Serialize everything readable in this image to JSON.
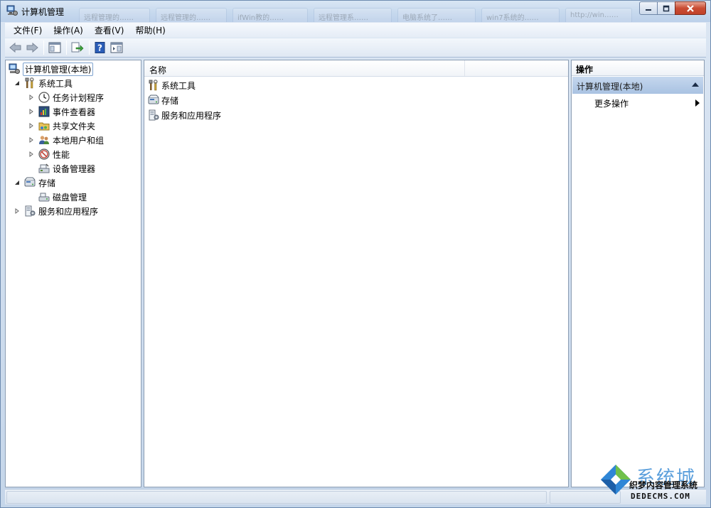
{
  "window": {
    "title": "计算机管理",
    "ghost_tabs": [
      "远程管理的……",
      "远程管理的……",
      "ifWin教的……",
      "远程管理系……",
      "电脑系统了……",
      "win7系统的……",
      "http://win……"
    ]
  },
  "menu": {
    "items": [
      {
        "label": "文件(F)"
      },
      {
        "label": "操作(A)"
      },
      {
        "label": "查看(V)"
      },
      {
        "label": "帮助(H)"
      }
    ]
  },
  "toolbar": {
    "buttons": [
      "back-icon",
      "forward-icon",
      "show-hide-tree-icon",
      "export-list-icon",
      "help-icon",
      "show-hide-action-pane-icon"
    ]
  },
  "tree": {
    "root": {
      "label": "计算机管理(本地)",
      "icon": "computer-management-icon"
    },
    "system_tools": {
      "label": "系统工具",
      "icon": "tools-icon"
    },
    "task_scheduler": {
      "label": "任务计划程序",
      "icon": "clock-icon"
    },
    "event_viewer": {
      "label": "事件查看器",
      "icon": "event-viewer-icon"
    },
    "shared_folders": {
      "label": "共享文件夹",
      "icon": "shared-folder-icon"
    },
    "local_users": {
      "label": "本地用户和组",
      "icon": "users-icon"
    },
    "performance": {
      "label": "性能",
      "icon": "performance-icon"
    },
    "device_manager": {
      "label": "设备管理器",
      "icon": "device-manager-icon"
    },
    "storage": {
      "label": "存储",
      "icon": "storage-icon"
    },
    "disk_management": {
      "label": "磁盘管理",
      "icon": "disk-icon"
    },
    "services_apps": {
      "label": "服务和应用程序",
      "icon": "services-icon"
    }
  },
  "list": {
    "header_name": "名称",
    "rows": [
      {
        "label": "系统工具",
        "icon": "tools-icon"
      },
      {
        "label": "存储",
        "icon": "storage-icon"
      },
      {
        "label": "服务和应用程序",
        "icon": "services-icon"
      }
    ]
  },
  "actions": {
    "header": "操作",
    "section_title": "计算机管理(本地)",
    "more_actions": "更多操作"
  },
  "watermark": {
    "big_text": "系统城",
    "line1": "织梦内容管理系统",
    "line2": "DEDECMS.COM"
  },
  "colors": {
    "title_gradient_top": "#d9e6f4",
    "action_section_bg": "#b7cce8",
    "close_button": "#c94c33",
    "watermark_blue": "#3f8fd6"
  }
}
